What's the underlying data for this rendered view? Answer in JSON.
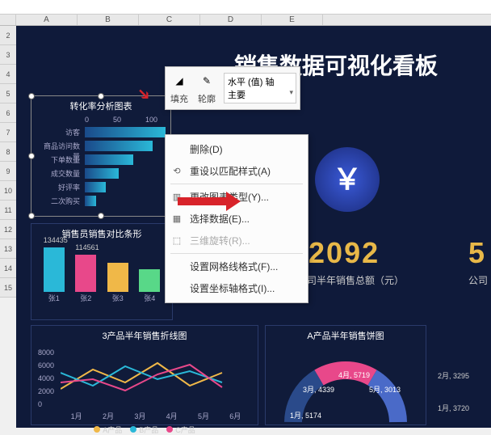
{
  "cols": [
    "A",
    "B",
    "C",
    "D",
    "E"
  ],
  "rows": [
    "2",
    "3",
    "4",
    "5",
    "6",
    "7",
    "8",
    "9",
    "10",
    "11",
    "12",
    "13",
    "14",
    "15"
  ],
  "title": "销售数据可视化看板",
  "coin_symbol": "￥",
  "bignum": "32092",
  "bignum2": "5",
  "sub": "司半年销售总额（元）",
  "sub2": "公司",
  "panel1": {
    "title": "转化率分析图表",
    "scale": [
      "0",
      "50",
      "100"
    ],
    "rows": [
      {
        "label": "访客",
        "w": 100
      },
      {
        "label": "商品访问数量",
        "w": 84
      },
      {
        "label": "下单数量",
        "w": 60
      },
      {
        "label": "成交数量",
        "w": 42
      },
      {
        "label": "好评率",
        "w": 26
      },
      {
        "label": "二次购买",
        "w": 14
      }
    ]
  },
  "panel2": {
    "title": "销售员销售对比条形",
    "bars": [
      {
        "v": "134435",
        "h": 55,
        "x": "张1",
        "c": "#2ab8d8"
      },
      {
        "v": "114561",
        "h": 46,
        "x": "张2",
        "c": "#e8488a"
      },
      {
        "v": "",
        "h": 36,
        "x": "张3",
        "c": "#f0b848"
      },
      {
        "v": "",
        "h": 28,
        "x": "张4",
        "c": "#58d888"
      }
    ]
  },
  "panel3": {
    "title": "3产品半年销售折线图",
    "y": [
      "8000",
      "6000",
      "4000",
      "2000",
      "0"
    ],
    "x": [
      "1月",
      "2月",
      "3月",
      "4月",
      "5月",
      "6月"
    ],
    "legend": [
      {
        "name": "A产品",
        "c": "#f0b848"
      },
      {
        "name": "B产品",
        "c": "#2ab8d8"
      },
      {
        "name": "C产品",
        "c": "#e8488a"
      }
    ]
  },
  "panel4": {
    "title": "A产品半年销售饼图",
    "labels": [
      "3月, 4339",
      "4月, 5719",
      "5月, 3013",
      "1月, 5174"
    ],
    "side": [
      "2月, 3295",
      "1月, 3720"
    ]
  },
  "minitool": {
    "fill": "填充",
    "outline": "轮廓",
    "combo": "水平 (值) 轴 主要"
  },
  "ctx": {
    "delete": "删除(D)",
    "reset": "重设以匹配样式(A)",
    "change": "更改图表类型(Y)...",
    "select": "选择数据(E)...",
    "rotate": "三维旋转(R)...",
    "grid": "设置网格线格式(F)...",
    "axis": "设置坐标轴格式(I)..."
  },
  "chart_data": [
    {
      "type": "bar",
      "orientation": "horizontal",
      "title": "转化率分析图表",
      "categories": [
        "访客",
        "商品访问数量",
        "下单数量",
        "成交数量",
        "好评率",
        "二次购买"
      ],
      "values": [
        100,
        84,
        60,
        42,
        26,
        14
      ],
      "xlim": [
        0,
        100
      ]
    },
    {
      "type": "bar",
      "title": "销售员销售对比条形图",
      "categories": [
        "张1",
        "张2",
        "张3",
        "张4"
      ],
      "values": [
        134435,
        114561,
        90000,
        70000
      ]
    },
    {
      "type": "line",
      "title": "3产品半年销售折线图",
      "categories": [
        "1月",
        "2月",
        "3月",
        "4月",
        "5月",
        "6月"
      ],
      "series": [
        {
          "name": "A产品",
          "values": [
            3000,
            5500,
            4000,
            6500,
            3500,
            5000
          ]
        },
        {
          "name": "B产品",
          "values": [
            5000,
            3500,
            6000,
            4500,
            5500,
            4000
          ]
        },
        {
          "name": "C产品",
          "values": [
            4000,
            4500,
            3000,
            5000,
            6000,
            3500
          ]
        }
      ],
      "ylim": [
        0,
        8000
      ]
    },
    {
      "type": "pie",
      "title": "A产品半年销售饼图",
      "slices": [
        {
          "label": "1月",
          "value": 5174
        },
        {
          "label": "2月",
          "value": 3295
        },
        {
          "label": "3月",
          "value": 4339
        },
        {
          "label": "4月",
          "value": 5719
        },
        {
          "label": "5月",
          "value": 3013
        },
        {
          "label": "1月",
          "value": 3720
        }
      ]
    }
  ]
}
